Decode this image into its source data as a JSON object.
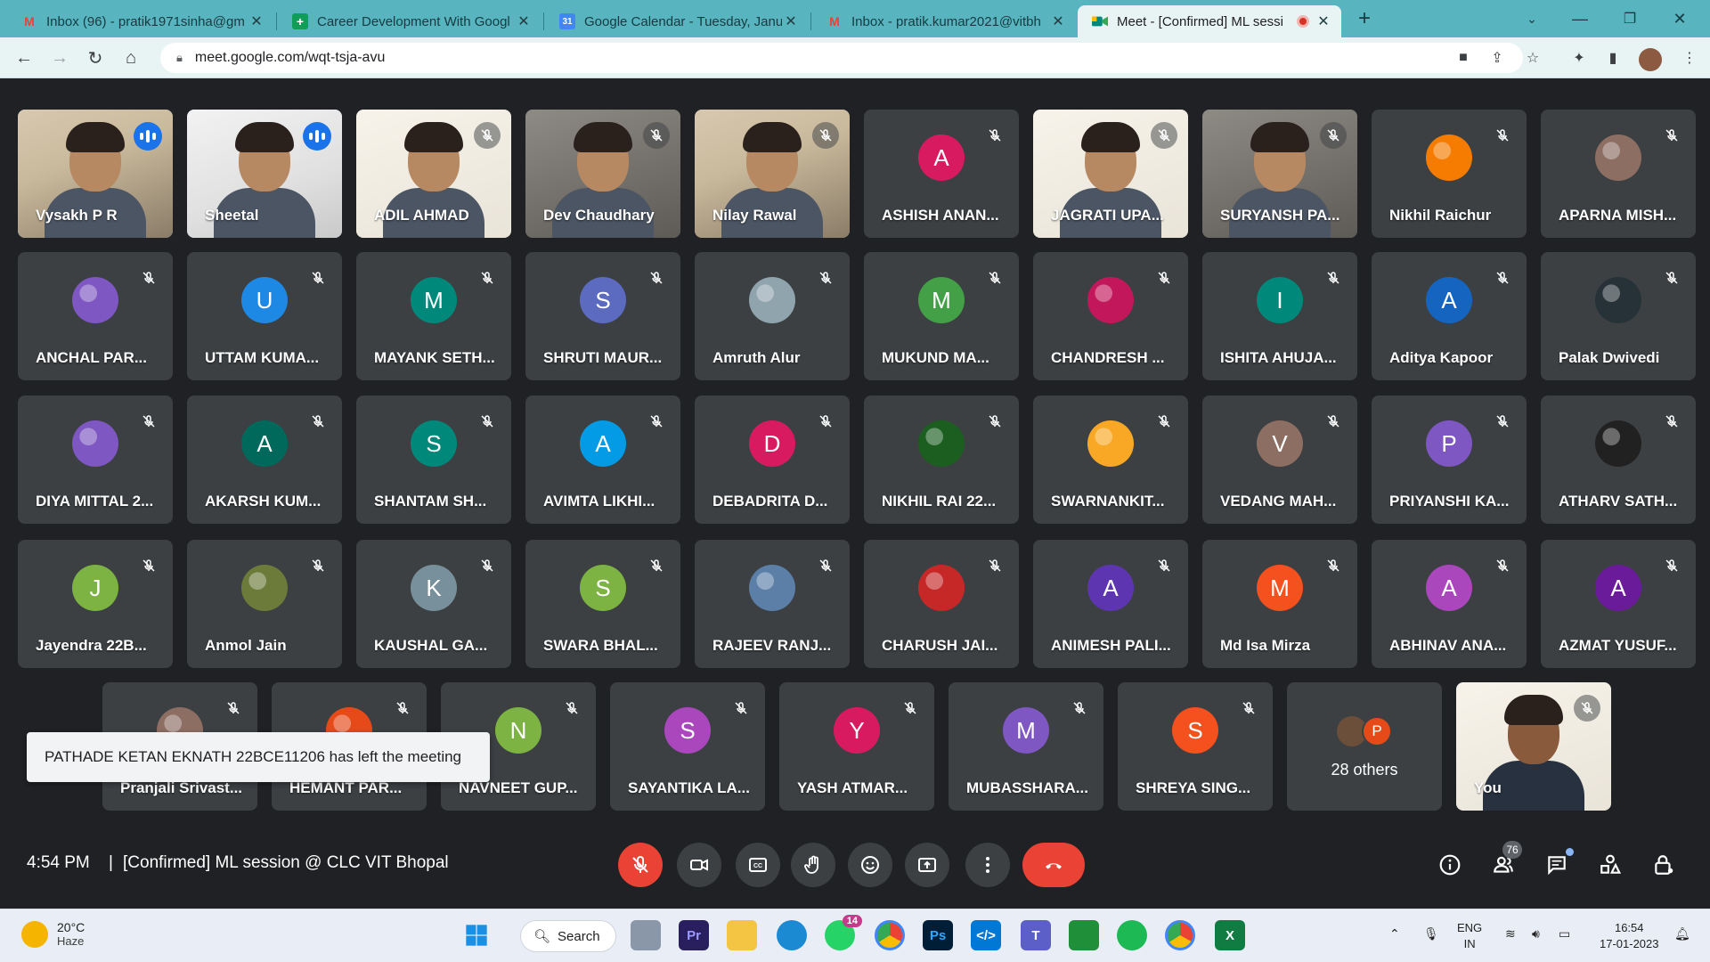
{
  "browser": {
    "tabs": [
      {
        "title": "Inbox (96) - pratik1971sinha@gm",
        "icon": "gmail-icon",
        "color": "#ea4335"
      },
      {
        "title": "Career Development With Googl",
        "icon": "sheets-icon",
        "color": "#0f9d58"
      },
      {
        "title": "Google Calendar - Tuesday, Janu",
        "icon": "calendar-icon",
        "color": "#4285f4"
      },
      {
        "title": "Inbox - pratik.kumar2021@vitbh",
        "icon": "gmail-icon",
        "color": "#ea4335"
      },
      {
        "title": "Meet - [Confirmed] ML sessi",
        "icon": "meet-icon",
        "color": "#00897b"
      }
    ],
    "url": "meet.google.com/wqt-tsja-avu"
  },
  "meet": {
    "participants_row1": [
      {
        "name": "Vysakh P R",
        "kind": "video",
        "speaking": true
      },
      {
        "name": "Sheetal",
        "kind": "video",
        "speaking": true
      },
      {
        "name": "ADIL AHMAD",
        "kind": "video"
      },
      {
        "name": "Dev Chaudhary",
        "kind": "video"
      },
      {
        "name": "Nilay Rawal",
        "kind": "video"
      },
      {
        "name": "ASHISH ANAN...",
        "kind": "letter",
        "letter": "A",
        "color": "#d81b60"
      },
      {
        "name": "JAGRATI UPA...",
        "kind": "video"
      },
      {
        "name": "SURYANSH PA...",
        "kind": "video"
      },
      {
        "name": "Nikhil Raichur",
        "kind": "image",
        "color": "#f57c00"
      },
      {
        "name": "APARNA MISH...",
        "kind": "image",
        "color": "#8d6e63"
      }
    ],
    "participants_row2": [
      {
        "name": "ANCHAL PAR...",
        "kind": "image",
        "color": "#7e57c2"
      },
      {
        "name": "UTTAM KUMA...",
        "kind": "letter",
        "letter": "U",
        "color": "#1e88e5"
      },
      {
        "name": "MAYANK SETH...",
        "kind": "letter",
        "letter": "M",
        "color": "#00897b"
      },
      {
        "name": "SHRUTI MAUR...",
        "kind": "letter",
        "letter": "S",
        "color": "#5c6bc0"
      },
      {
        "name": "Amruth Alur",
        "kind": "image",
        "color": "#90a4ae"
      },
      {
        "name": "MUKUND MA...",
        "kind": "letter",
        "letter": "M",
        "color": "#43a047"
      },
      {
        "name": "CHANDRESH ...",
        "kind": "image",
        "color": "#c2185b"
      },
      {
        "name": "ISHITA AHUJA...",
        "kind": "letter",
        "letter": "I",
        "color": "#00897b"
      },
      {
        "name": "Aditya Kapoor",
        "kind": "letter",
        "letter": "A",
        "color": "#1565c0"
      },
      {
        "name": "Palak Dwivedi",
        "kind": "image",
        "color": "#263238"
      }
    ],
    "participants_row3": [
      {
        "name": "DIYA MITTAL 2...",
        "kind": "image",
        "color": "#7e57c2"
      },
      {
        "name": "AKARSH KUM...",
        "kind": "letter",
        "letter": "A",
        "color": "#00695c"
      },
      {
        "name": "SHANTAM SH...",
        "kind": "letter",
        "letter": "S",
        "color": "#00897b"
      },
      {
        "name": "AVIMTA LIKHI...",
        "kind": "letter",
        "letter": "A",
        "color": "#039be5"
      },
      {
        "name": "DEBADRITA D...",
        "kind": "letter",
        "letter": "D",
        "color": "#d81b60"
      },
      {
        "name": "NIKHIL RAI 22...",
        "kind": "image",
        "color": "#1b5e20"
      },
      {
        "name": "SWARNANKIT...",
        "kind": "image",
        "color": "#f9a825"
      },
      {
        "name": "VEDANG MAH...",
        "kind": "letter",
        "letter": "V",
        "color": "#8d6e63"
      },
      {
        "name": "PRIYANSHI KA...",
        "kind": "letter",
        "letter": "P",
        "color": "#7e57c2"
      },
      {
        "name": "ATHARV SATH...",
        "kind": "image",
        "color": "#212121"
      }
    ],
    "participants_row4": [
      {
        "name": "Jayendra 22B...",
        "kind": "letter",
        "letter": "J",
        "color": "#7cb342"
      },
      {
        "name": "Anmol Jain",
        "kind": "image",
        "color": "#6d7b3a"
      },
      {
        "name": "KAUSHAL GA...",
        "kind": "letter",
        "letter": "K",
        "color": "#78909c"
      },
      {
        "name": "SWARA BHAL...",
        "kind": "letter",
        "letter": "S",
        "color": "#7cb342"
      },
      {
        "name": "RAJEEV RANJ...",
        "kind": "image",
        "color": "#5c7fa8"
      },
      {
        "name": "CHARUSH JAI...",
        "kind": "image",
        "color": "#c62828"
      },
      {
        "name": "ANIMESH PALI...",
        "kind": "letter",
        "letter": "A",
        "color": "#5e35b1"
      },
      {
        "name": "Md Isa Mirza",
        "kind": "letter",
        "letter": "M",
        "color": "#f4511e"
      },
      {
        "name": "ABHINAV ANA...",
        "kind": "letter",
        "letter": "A",
        "color": "#ab47bc"
      },
      {
        "name": "AZMAT YUSUF...",
        "kind": "letter",
        "letter": "A",
        "color": "#6a1b9a"
      }
    ],
    "participants_row5": [
      {
        "name": "Pranjali Srivast...",
        "kind": "image",
        "color": "#8d6e63"
      },
      {
        "name": "HEMANT PAR...",
        "kind": "image",
        "color": "#e64a19"
      },
      {
        "name": "NAVNEET GUP...",
        "kind": "letter",
        "letter": "N",
        "color": "#7cb342"
      },
      {
        "name": "SAYANTIKA LA...",
        "kind": "letter",
        "letter": "S",
        "color": "#ab47bc"
      },
      {
        "name": "YASH ATMAR...",
        "kind": "letter",
        "letter": "Y",
        "color": "#d81b60"
      },
      {
        "name": "MUBASSHARA...",
        "kind": "letter",
        "letter": "M",
        "color": "#7e57c2"
      },
      {
        "name": "SHREYA SING...",
        "kind": "letter",
        "letter": "S",
        "color": "#f4511e"
      }
    ],
    "others_label": "28 others",
    "others_letter": "P",
    "you_label": "You",
    "toast": "PATHADE KETAN EKNATH 22BCE11206 has left the meeting",
    "time": "4:54 PM",
    "separator": "|",
    "meeting_title": "[Confirmed] ML session @ CLC VIT Bhopal",
    "people_count": "76"
  },
  "taskbar": {
    "temperature": "20°C",
    "weather": "Haze",
    "search_label": "Search",
    "whatsapp_badge": "14",
    "lang_line1": "ENG",
    "lang_line2": "IN",
    "time": "16:54",
    "date": "17-01-2023"
  },
  "colors": {
    "accent": "#1a73e8",
    "danger": "#ea4335",
    "tile_bg": "#3c4043",
    "page_bg": "#202124"
  }
}
